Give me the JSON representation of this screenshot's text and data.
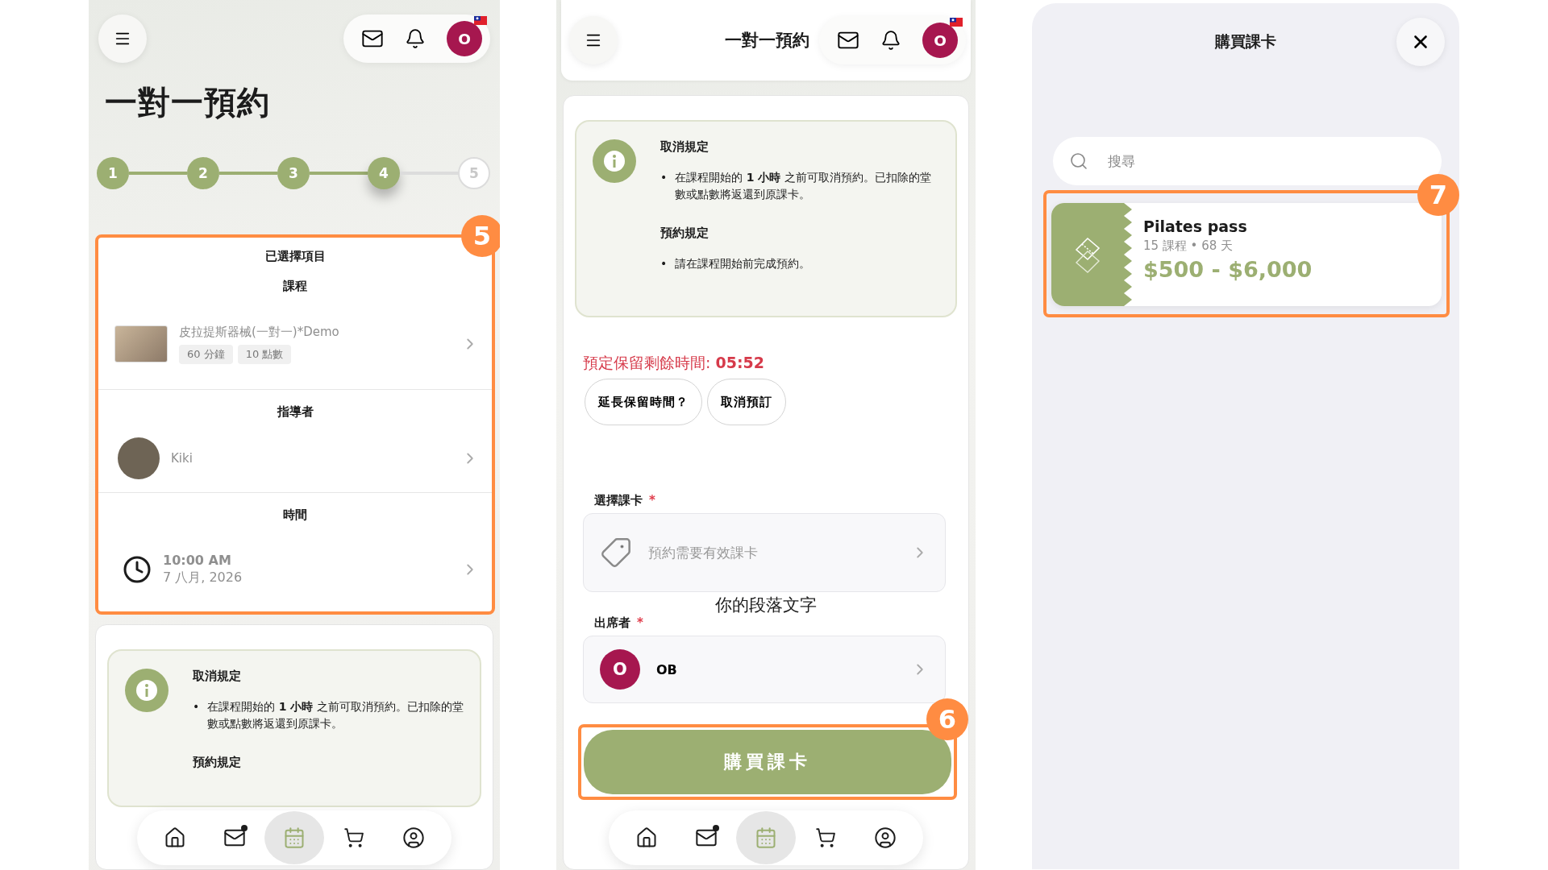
{
  "screen_1": {
    "header": {
      "avatar_letter": "O"
    },
    "title": "一對一預約",
    "steps": [
      {
        "label": "1",
        "completed": true,
        "selected": false
      },
      {
        "label": "2",
        "completed": true,
        "selected": false
      },
      {
        "label": "3",
        "completed": true,
        "selected": false
      },
      {
        "label": "4",
        "completed": true,
        "selected": true
      },
      {
        "label": "5",
        "completed": false,
        "selected": false
      }
    ],
    "summary": {
      "callout": "5",
      "title": "已選擇項目",
      "sections": [
        {
          "kind": "course",
          "heading": "課程",
          "name": "皮拉提斯器械(一對一)*Demo",
          "tags": [
            "60 分鐘",
            "10 點數"
          ]
        },
        {
          "kind": "instructor",
          "heading": "指導者",
          "name": "Kiki"
        },
        {
          "kind": "time",
          "heading": "時間",
          "time": "10:00 AM",
          "date": "7 八月, 2026"
        }
      ]
    },
    "policy": {
      "cancel_title": "取消規定",
      "cancel_rules": [
        {
          "marker": "•",
          "text": "在課程開始的 **1 小時** 之前可取消預約。已扣除的堂數或點數將返還到原課卡。"
        }
      ],
      "booking_title": "預約規定"
    },
    "nav": [
      {
        "kind": "home",
        "selected": false
      },
      {
        "kind": "mail",
        "selected": false
      },
      {
        "kind": "calendar",
        "selected": true
      },
      {
        "kind": "cart",
        "selected": false
      },
      {
        "kind": "profile",
        "selected": false
      }
    ]
  },
  "screen_2": {
    "header": {
      "title": "一對一預約",
      "avatar_letter": "O"
    },
    "policy": {
      "cancel_title": "取消規定",
      "cancel_rules": [
        {
          "marker": "•",
          "text": "在課程開始的 **1 小時** 之前可取消預約。已扣除的堂數或點數將返還到原課卡。"
        }
      ],
      "booking_title": "預約規定",
      "booking_rules": [
        {
          "marker": "•",
          "text": "請在課程開始前完成預約。"
        }
      ]
    },
    "hold_timer": "預定保留剩餘時間: **05:52**",
    "hold_buttons": [
      "延長保留時間？",
      "取消預訂"
    ],
    "pass_field": {
      "label": "選擇課卡",
      "required_mark": "*",
      "placeholder": "預約需要有效課卡"
    },
    "stray_text": "你的段落文字",
    "attendee_field": {
      "label": "出席者",
      "required_mark": "*",
      "avatar_letter": "O",
      "name": "OB"
    },
    "buy_button": {
      "label": "購買課卡",
      "callout": "6"
    },
    "nav": [
      {
        "kind": "home",
        "selected": false
      },
      {
        "kind": "mail",
        "selected": false
      },
      {
        "kind": "calendar",
        "selected": true
      },
      {
        "kind": "cart",
        "selected": false
      },
      {
        "kind": "profile",
        "selected": false
      }
    ]
  },
  "screen_3": {
    "title": "購買課卡",
    "search": {
      "placeholder": "搜尋"
    },
    "callout": "7",
    "passes": [
      {
        "name": "Pilates pass",
        "detail": "15 課程 • 68 天",
        "price": "$500 - $6,000"
      }
    ]
  }
}
